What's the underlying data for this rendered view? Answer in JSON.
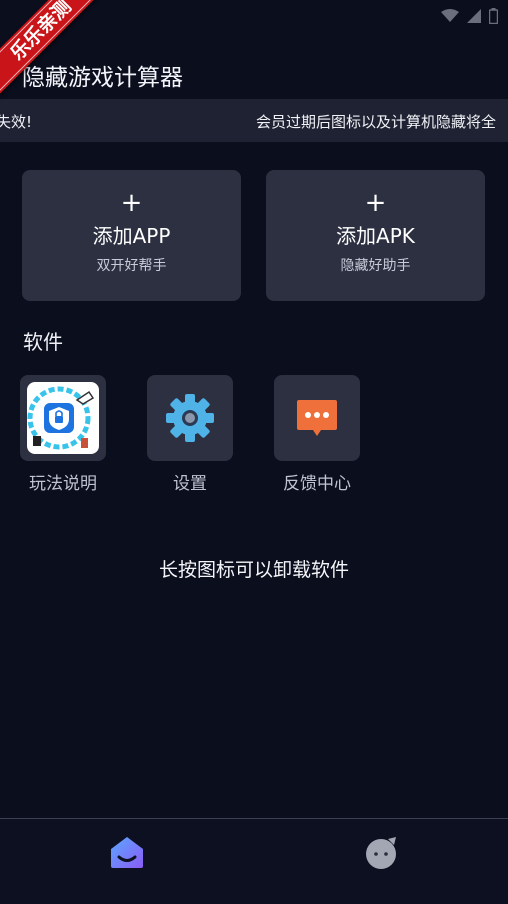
{
  "ribbon": {
    "text": "乐乐亲测"
  },
  "header": {
    "title": "隐藏游戏计算器"
  },
  "marquee": {
    "segment_left": "失效!",
    "segment_right": "会员过期后图标以及计算机隐藏将全"
  },
  "cards": [
    {
      "plus": "+",
      "title": "添加APP",
      "subtitle": "双开好帮手"
    },
    {
      "plus": "+",
      "title": "添加APK",
      "subtitle": "隐藏好助手"
    }
  ],
  "section": {
    "title": "软件"
  },
  "apps": [
    {
      "label": "玩法说明",
      "icon": "guide-shield-icon"
    },
    {
      "label": "设置",
      "icon": "gear-icon"
    },
    {
      "label": "反馈中心",
      "icon": "chat-bubble-icon"
    }
  ],
  "hint": {
    "text": "长按图标可以卸载软件"
  },
  "bottom_nav": [
    {
      "name": "home",
      "icon": "home-icon",
      "active": true
    },
    {
      "name": "profile",
      "icon": "mascot-icon",
      "active": false
    }
  ],
  "colors": {
    "background": "#0b0e1d",
    "card": "#2c3041",
    "gear": "#4fb3e8",
    "chat": "#f0703c",
    "home_active": "#7b6cf6",
    "ribbon": "#c91419"
  }
}
